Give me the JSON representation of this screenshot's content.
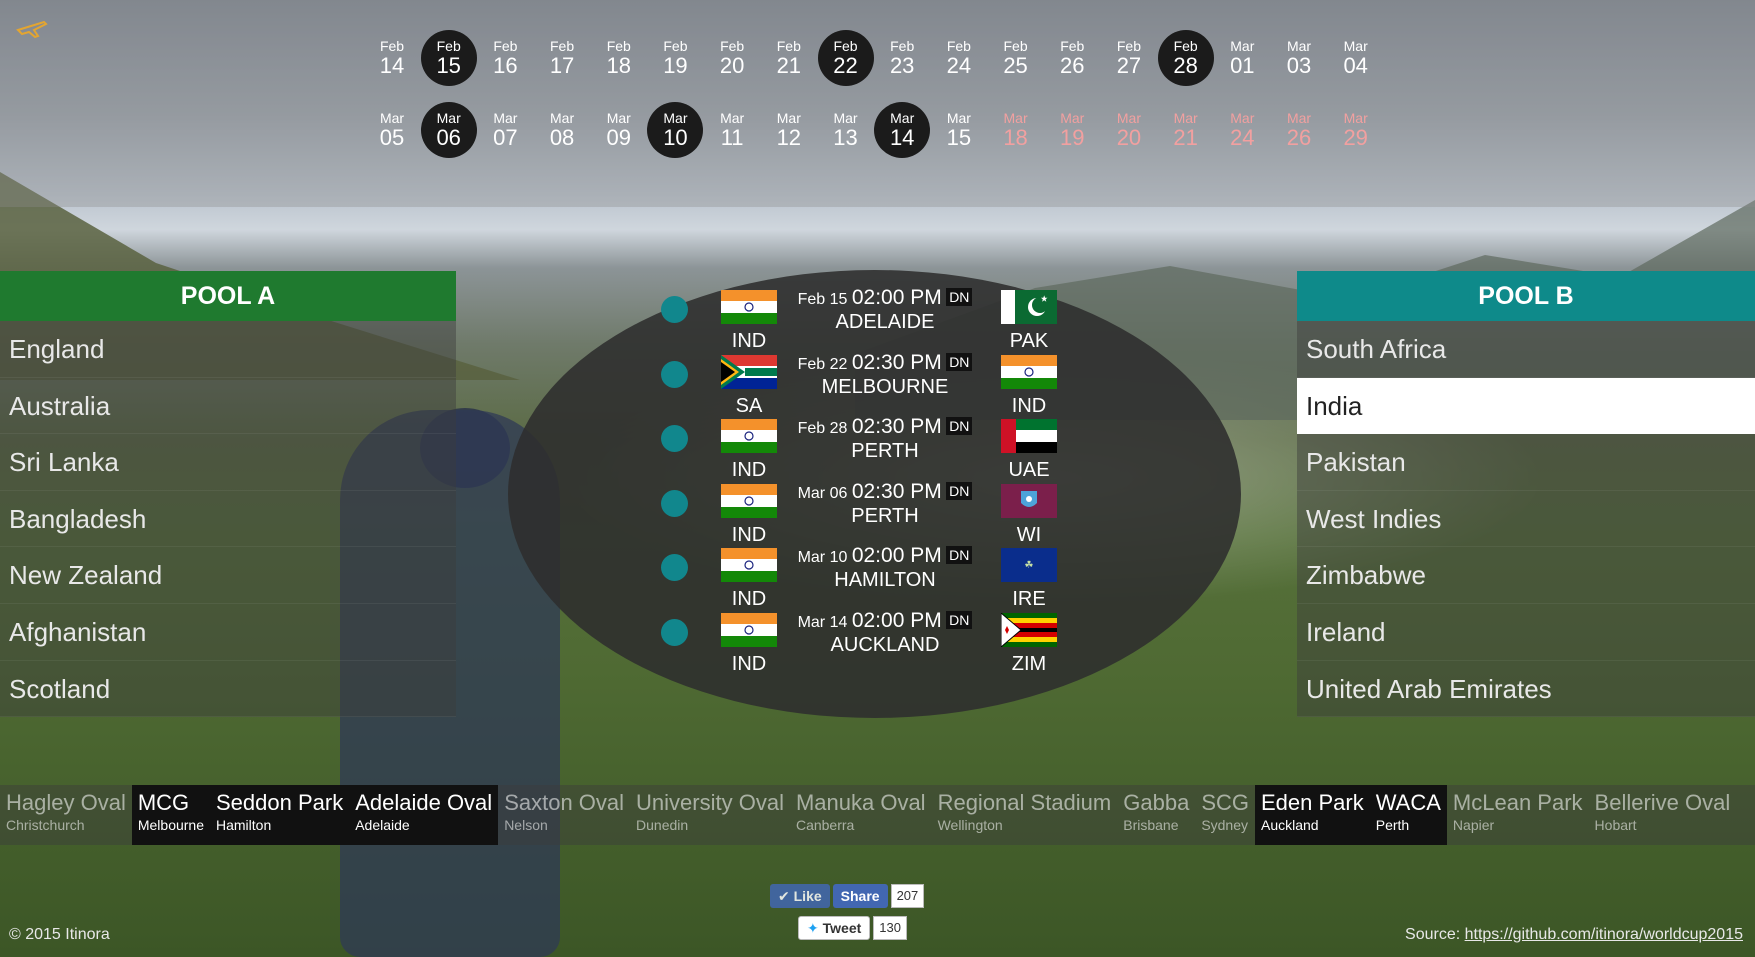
{
  "calendar": {
    "row1": [
      {
        "month": "Feb",
        "day": "14",
        "state": "normal"
      },
      {
        "month": "Feb",
        "day": "15",
        "state": "active"
      },
      {
        "month": "Feb",
        "day": "16",
        "state": "normal"
      },
      {
        "month": "Feb",
        "day": "17",
        "state": "normal"
      },
      {
        "month": "Feb",
        "day": "18",
        "state": "normal"
      },
      {
        "month": "Feb",
        "day": "19",
        "state": "normal"
      },
      {
        "month": "Feb",
        "day": "20",
        "state": "normal"
      },
      {
        "month": "Feb",
        "day": "21",
        "state": "normal"
      },
      {
        "month": "Feb",
        "day": "22",
        "state": "active"
      },
      {
        "month": "Feb",
        "day": "23",
        "state": "normal"
      },
      {
        "month": "Feb",
        "day": "24",
        "state": "normal"
      },
      {
        "month": "Feb",
        "day": "25",
        "state": "normal"
      },
      {
        "month": "Feb",
        "day": "26",
        "state": "normal"
      },
      {
        "month": "Feb",
        "day": "27",
        "state": "normal"
      },
      {
        "month": "Feb",
        "day": "28",
        "state": "active"
      },
      {
        "month": "Mar",
        "day": "01",
        "state": "normal"
      },
      {
        "month": "Mar",
        "day": "03",
        "state": "normal"
      },
      {
        "month": "Mar",
        "day": "04",
        "state": "normal"
      }
    ],
    "row2": [
      {
        "month": "Mar",
        "day": "05",
        "state": "normal"
      },
      {
        "month": "Mar",
        "day": "06",
        "state": "active"
      },
      {
        "month": "Mar",
        "day": "07",
        "state": "normal"
      },
      {
        "month": "Mar",
        "day": "08",
        "state": "normal"
      },
      {
        "month": "Mar",
        "day": "09",
        "state": "normal"
      },
      {
        "month": "Mar",
        "day": "10",
        "state": "active"
      },
      {
        "month": "Mar",
        "day": "11",
        "state": "normal"
      },
      {
        "month": "Mar",
        "day": "12",
        "state": "normal"
      },
      {
        "month": "Mar",
        "day": "13",
        "state": "normal"
      },
      {
        "month": "Mar",
        "day": "14",
        "state": "active"
      },
      {
        "month": "Mar",
        "day": "15",
        "state": "normal"
      },
      {
        "month": "Mar",
        "day": "18",
        "state": "future"
      },
      {
        "month": "Mar",
        "day": "19",
        "state": "future"
      },
      {
        "month": "Mar",
        "day": "20",
        "state": "future"
      },
      {
        "month": "Mar",
        "day": "21",
        "state": "future"
      },
      {
        "month": "Mar",
        "day": "24",
        "state": "future"
      },
      {
        "month": "Mar",
        "day": "26",
        "state": "future"
      },
      {
        "month": "Mar",
        "day": "29",
        "state": "future"
      }
    ]
  },
  "pool_a": {
    "title": "POOL A",
    "teams": [
      "England",
      "Australia",
      "Sri Lanka",
      "Bangladesh",
      "New Zealand",
      "Afghanistan",
      "Scotland"
    ]
  },
  "pool_b": {
    "title": "POOL B",
    "teams": [
      "South Africa",
      "India",
      "Pakistan",
      "West Indies",
      "Zimbabwe",
      "Ireland",
      "United Arab Emirates"
    ],
    "selected_index": 1
  },
  "matches": [
    {
      "date": "Feb 15",
      "time": "02:00 PM",
      "dn": "DN",
      "venue": "ADELAIDE",
      "team1": "IND",
      "team2": "PAK",
      "flag1": "ind",
      "flag2": "pak"
    },
    {
      "date": "Feb 22",
      "time": "02:30 PM",
      "dn": "DN",
      "venue": "MELBOURNE",
      "team1": "SA",
      "team2": "IND",
      "flag1": "sa",
      "flag2": "ind"
    },
    {
      "date": "Feb 28",
      "time": "02:30 PM",
      "dn": "DN",
      "venue": "PERTH",
      "team1": "IND",
      "team2": "UAE",
      "flag1": "ind",
      "flag2": "uae"
    },
    {
      "date": "Mar 06",
      "time": "02:30 PM",
      "dn": "DN",
      "venue": "PERTH",
      "team1": "IND",
      "team2": "WI",
      "flag1": "ind",
      "flag2": "wi"
    },
    {
      "date": "Mar 10",
      "time": "02:00 PM",
      "dn": "DN",
      "venue": "HAMILTON",
      "team1": "IND",
      "team2": "IRE",
      "flag1": "ind",
      "flag2": "ire"
    },
    {
      "date": "Mar 14",
      "time": "02:00 PM",
      "dn": "DN",
      "venue": "AUCKLAND",
      "team1": "IND",
      "team2": "ZIM",
      "flag1": "ind",
      "flag2": "zim"
    }
  ],
  "venues": [
    {
      "name": "Hagley Oval",
      "city": "Christchurch",
      "active": false
    },
    {
      "name": "MCG",
      "city": "Melbourne",
      "active": true
    },
    {
      "name": "Seddon Park",
      "city": "Hamilton",
      "active": true
    },
    {
      "name": "Adelaide Oval",
      "city": "Adelaide",
      "active": true
    },
    {
      "name": "Saxton Oval",
      "city": "Nelson",
      "active": false
    },
    {
      "name": "University Oval",
      "city": "Dunedin",
      "active": false
    },
    {
      "name": "Manuka Oval",
      "city": "Canberra",
      "active": false
    },
    {
      "name": "Regional Stadium",
      "city": "Wellington",
      "active": false
    },
    {
      "name": "Gabba",
      "city": "Brisbane",
      "active": false
    },
    {
      "name": "SCG",
      "city": "Sydney",
      "active": false
    },
    {
      "name": "Eden Park",
      "city": "Auckland",
      "active": true
    },
    {
      "name": "WACA",
      "city": "Perth",
      "active": true
    },
    {
      "name": "McLean Park",
      "city": "Napier",
      "active": false
    },
    {
      "name": "Bellerive Oval",
      "city": "Hobart",
      "active": false
    }
  ],
  "social": {
    "like_label": "Like",
    "share_label": "Share",
    "like_count": "207",
    "tweet_label": "Tweet",
    "tweet_count": "130"
  },
  "footer": {
    "copyright": "© 2015 Itinora",
    "source_prefix": "Source: ",
    "source_link": "https://github.com/itinora/worldcup2015"
  },
  "colors": {
    "pool_a": "#1f7a2f",
    "pool_b": "#0e8a8a",
    "dot": "#11878d",
    "future_date": "#f2a0a0"
  }
}
